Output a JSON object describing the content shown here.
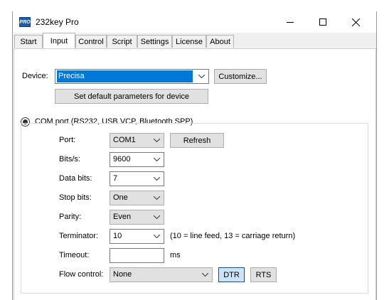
{
  "window": {
    "title": "232key Pro",
    "icon_text": "PRO"
  },
  "tabs": [
    "Start",
    "Input",
    "Control",
    "Script",
    "Settings",
    "License",
    "About"
  ],
  "device": {
    "label": "Device:",
    "value": "Precisa",
    "customize_label": "Customize...",
    "set_default_label": "Set default parameters for device"
  },
  "com_port": {
    "label": "COM port (RS232, USB VCP, Bluetooth SPP)",
    "selected": true,
    "port_label": "Port:",
    "port_value": "COM1",
    "refresh_label": "Refresh",
    "bits_label": "Bits/s:",
    "bits_value": "9600",
    "databits_label": "Data bits:",
    "databits_value": "7",
    "stopbits_label": "Stop bits:",
    "stopbits_value": "One",
    "parity_label": "Parity:",
    "parity_value": "Even",
    "terminator_label": "Terminator:",
    "terminator_value": "10",
    "terminator_hint": "(10 = line feed, 13 = carriage return)",
    "timeout_label": "Timeout:",
    "timeout_value": "",
    "timeout_unit": "ms",
    "flow_label": "Flow control:",
    "flow_value": "None",
    "dtr_label": "DTR",
    "rts_label": "RTS"
  }
}
